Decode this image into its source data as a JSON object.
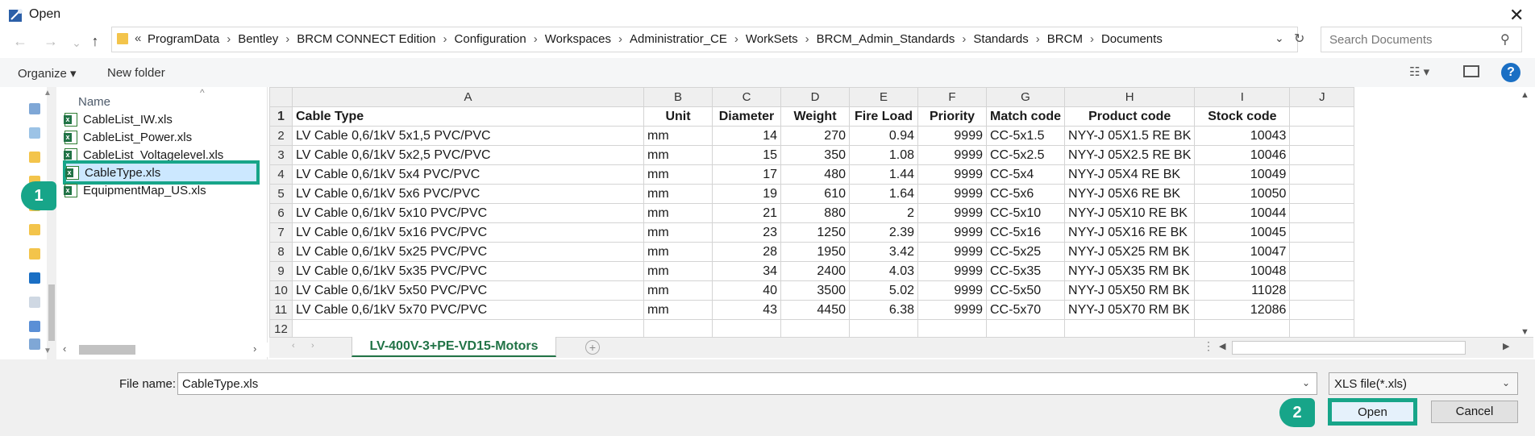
{
  "window": {
    "title": "Open",
    "close_glyph": "✕"
  },
  "nav": {
    "back": "←",
    "forward": "→",
    "up": "↑",
    "dropdown": "⌄"
  },
  "address": {
    "prefix": "«",
    "crumbs": [
      "ProgramData",
      "Bentley",
      "BRCM CONNECT Edition",
      "Configuration",
      "Workspaces",
      "Administratior_CE",
      "WorkSets",
      "BRCM_Admin_Standards",
      "Standards",
      "BRCM",
      "Documents"
    ],
    "separator": "›",
    "dropdown": "⌄",
    "refresh": "↻"
  },
  "search": {
    "placeholder": "Search Documents",
    "icon": "⚲"
  },
  "toolbar": {
    "organize": "Organize ▾",
    "new_folder": "New folder",
    "view_glyph": "☷ ▾",
    "help": "?"
  },
  "file_list": {
    "column": "Name",
    "sort_caret": "^",
    "files": [
      "CableList_IW.xls",
      "CableList_Power.xls",
      "CableList_Voltagelevel.xls",
      "CableType.xls",
      "EquipmentMap_US.xls"
    ],
    "selected_index": 3
  },
  "scroll_glyphs": {
    "left": "‹",
    "right": "›",
    "up": "▲",
    "down": "▼",
    "tab_left": "◀",
    "tab_right": "▶"
  },
  "badges": {
    "one": "1",
    "two": "2"
  },
  "sheet": {
    "columns": [
      "A",
      "B",
      "C",
      "D",
      "E",
      "F",
      "G",
      "H",
      "I",
      "J"
    ],
    "header_row": [
      "Cable Type",
      "Unit",
      "Diameter",
      "Weight",
      "Fire Load",
      "Priority",
      "Match code",
      "Product code",
      "Stock code",
      ""
    ],
    "rows": [
      [
        "LV Cable 0,6/1kV 5x1,5 PVC/PVC",
        "mm",
        "14",
        "270",
        "0.94",
        "9999",
        "CC-5x1.5",
        "NYY-J 05X1.5 RE BK",
        "10043",
        ""
      ],
      [
        "LV Cable 0,6/1kV 5x2,5 PVC/PVC",
        "mm",
        "15",
        "350",
        "1.08",
        "9999",
        "CC-5x2.5",
        "NYY-J 05X2.5 RE BK",
        "10046",
        ""
      ],
      [
        "LV Cable 0,6/1kV 5x4 PVC/PVC",
        "mm",
        "17",
        "480",
        "1.44",
        "9999",
        "CC-5x4",
        "NYY-J 05X4 RE BK",
        "10049",
        ""
      ],
      [
        "LV Cable 0,6/1kV 5x6 PVC/PVC",
        "mm",
        "19",
        "610",
        "1.64",
        "9999",
        "CC-5x6",
        "NYY-J 05X6 RE BK",
        "10050",
        ""
      ],
      [
        "LV Cable 0,6/1kV 5x10 PVC/PVC",
        "mm",
        "21",
        "880",
        "2",
        "9999",
        "CC-5x10",
        "NYY-J 05X10 RE BK",
        "10044",
        ""
      ],
      [
        "LV Cable 0,6/1kV 5x16 PVC/PVC",
        "mm",
        "23",
        "1250",
        "2.39",
        "9999",
        "CC-5x16",
        "NYY-J 05X16 RE BK",
        "10045",
        ""
      ],
      [
        "LV Cable 0,6/1kV 5x25 PVC/PVC",
        "mm",
        "28",
        "1950",
        "3.42",
        "9999",
        "CC-5x25",
        "NYY-J 05X25 RM BK",
        "10047",
        ""
      ],
      [
        "LV Cable 0,6/1kV 5x35 PVC/PVC",
        "mm",
        "34",
        "2400",
        "4.03",
        "9999",
        "CC-5x35",
        "NYY-J 05X35 RM BK",
        "10048",
        ""
      ],
      [
        "LV Cable 0,6/1kV 5x50 PVC/PVC",
        "mm",
        "40",
        "3500",
        "5.02",
        "9999",
        "CC-5x50",
        "NYY-J 05X50 RM BK",
        "11028",
        ""
      ],
      [
        "LV Cable 0,6/1kV 5x70 PVC/PVC",
        "mm",
        "43",
        "4450",
        "6.38",
        "9999",
        "CC-5x70",
        "NYY-J 05X70 RM BK",
        "12086",
        ""
      ],
      [
        "",
        "",
        "",
        "",
        "",
        "",
        "",
        "",
        "",
        ""
      ]
    ],
    "tab_name": "LV-400V-3+PE-VD15-Motors",
    "add_sheet": "+",
    "tab_dots": "⋮"
  },
  "footer": {
    "file_name_label": "File name:",
    "file_name_value": "CableType.xls",
    "file_type": "XLS file(*.xls)",
    "dropdown": "⌄",
    "open": "Open",
    "cancel": "Cancel"
  },
  "colors": {
    "accent": "#17a589",
    "excel_green": "#217346",
    "selection": "#cce8ff",
    "help_blue": "#1a6fc4"
  }
}
